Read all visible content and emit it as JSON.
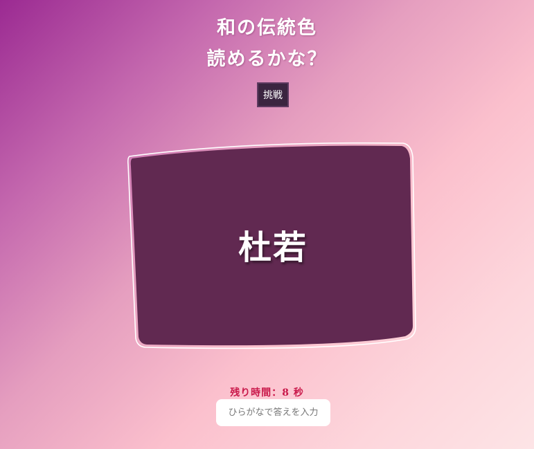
{
  "title": {
    "line1": "和の伝統色",
    "line2": "読めるかな？"
  },
  "challenge_button": {
    "label": "挑戦"
  },
  "card": {
    "word": "杜若",
    "color": "#612951"
  },
  "timer": {
    "label": "残り時間：",
    "seconds": "8",
    "unit": "秒"
  },
  "answer_input": {
    "placeholder": "ひらがなで答えを入力",
    "value": ""
  }
}
